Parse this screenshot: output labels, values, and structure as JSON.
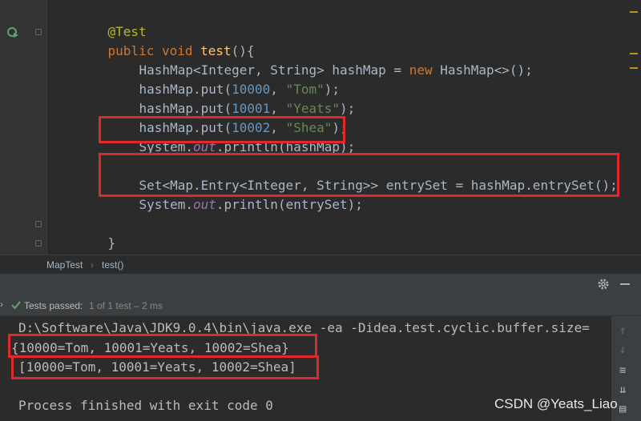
{
  "editor": {
    "lines": {
      "annotation": "@Test",
      "method_modifiers": "public void ",
      "method_name": "test",
      "method_open": "(){",
      "decl_type": "HashMap<Integer, String> hashMap = ",
      "decl_new": "new",
      "decl_rest": " HashMap<>();",
      "put_prefix": "hashMap.put(",
      "put1_key": "10000",
      "put1_val": "\"Tom\"",
      "put2_key": "10001",
      "put2_val": "\"Yeats\"",
      "put3_key": "10002",
      "put3_val": "\"Shea\"",
      "comma": ", ",
      "put_suffix": ");",
      "print_prefix": "System.",
      "print_out": "out",
      "print1_rest": ".println(hashMap);",
      "set_line": "Set<Map.Entry<Integer, String>> entrySet = hashMap.entrySet();",
      "print2_rest": ".println(entrySet);",
      "close_method": "}",
      "close_class": "}"
    },
    "highlight_color": "#e0292b"
  },
  "breadcrumb": {
    "class_name": "MapTest",
    "separator": "›",
    "method_name": "test()"
  },
  "toolbar": {
    "test_status": "Tests passed:",
    "test_count": "1 of 1 test – 2 ms",
    "settings_icon": "gear-icon"
  },
  "console": {
    "command": "D:\\Software\\Java\\JDK9.0.4\\bin\\java.exe -ea -Didea.test.cyclic.buffer.size=",
    "output_map": "{10000=Tom, 10001=Yeats, 10002=Shea}",
    "output_set": "[10000=Tom, 10001=Yeats, 10002=Shea]",
    "exit_message": "Process finished with exit code 0"
  },
  "watermark": "CSDN @Yeats_Liao"
}
